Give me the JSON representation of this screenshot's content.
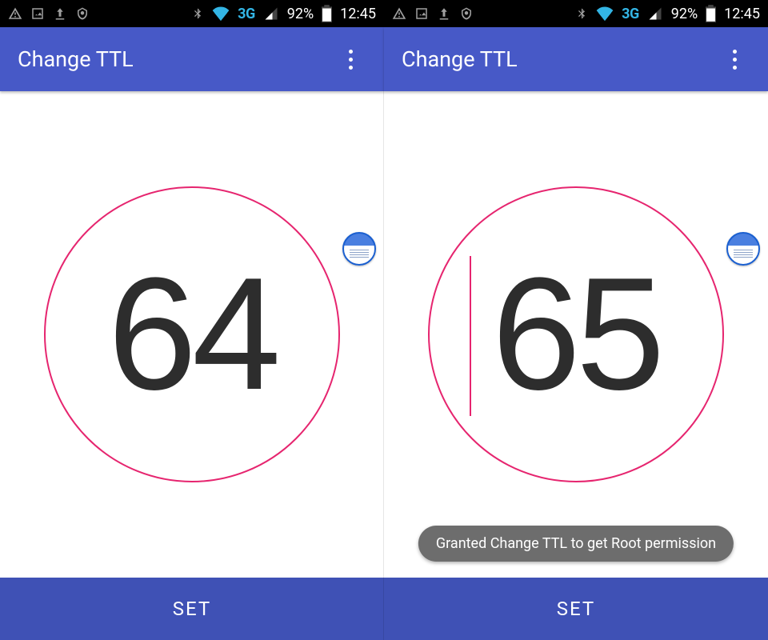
{
  "status_bar": {
    "network_label": "3G",
    "battery_percent": "92%",
    "time": "12:45"
  },
  "panes": [
    {
      "app_title": "Change TTL",
      "ttl_value": "64",
      "editing": false,
      "set_button_label": "SET",
      "toast": null
    },
    {
      "app_title": "Change TTL",
      "ttl_value": "65",
      "editing": true,
      "set_button_label": "SET",
      "toast": "Granted Change TTL to get Root permission"
    }
  ],
  "colors": {
    "accent": "#e6256f",
    "primary": "#4759c7",
    "primary_dark": "#3f51b5"
  }
}
